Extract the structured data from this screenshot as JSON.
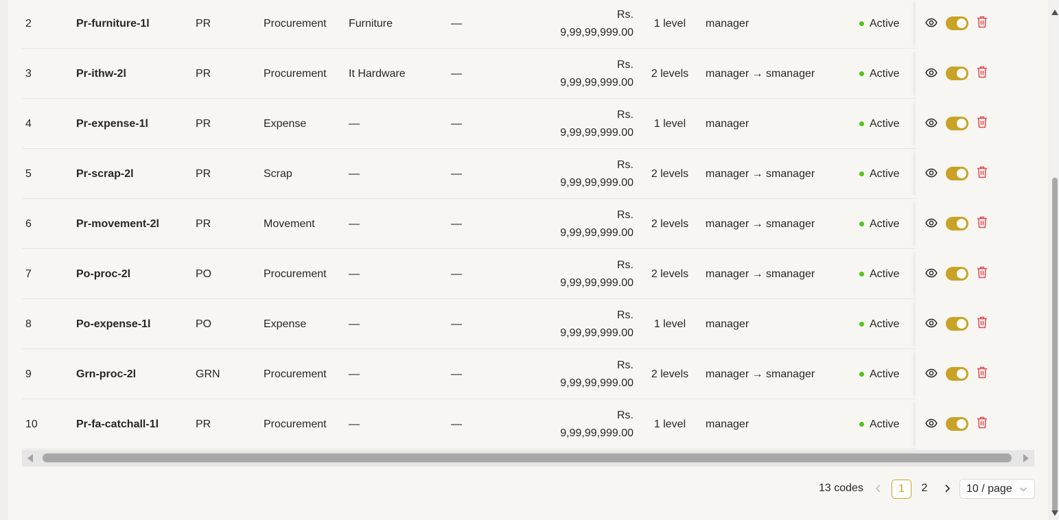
{
  "rows": [
    {
      "no": "2",
      "code": "Pr-furniture-1l",
      "type": "PR",
      "category": "Procurement",
      "subcategory": "Furniture",
      "dept": "—",
      "currency": "Rs.",
      "amount": "9,99,99,999.00",
      "levels": "1 level",
      "chain": "manager",
      "status": "Active"
    },
    {
      "no": "3",
      "code": "Pr-ithw-2l",
      "type": "PR",
      "category": "Procurement",
      "subcategory": "It Hardware",
      "dept": "—",
      "currency": "Rs.",
      "amount": "9,99,99,999.00",
      "levels": "2 levels",
      "chain": "manager → smanager",
      "status": "Active"
    },
    {
      "no": "4",
      "code": "Pr-expense-1l",
      "type": "PR",
      "category": "Expense",
      "subcategory": "—",
      "dept": "—",
      "currency": "Rs.",
      "amount": "9,99,99,999.00",
      "levels": "1 level",
      "chain": "manager",
      "status": "Active"
    },
    {
      "no": "5",
      "code": "Pr-scrap-2l",
      "type": "PR",
      "category": "Scrap",
      "subcategory": "—",
      "dept": "—",
      "currency": "Rs.",
      "amount": "9,99,99,999.00",
      "levels": "2 levels",
      "chain": "manager → smanager",
      "status": "Active"
    },
    {
      "no": "6",
      "code": "Pr-movement-2l",
      "type": "PR",
      "category": "Movement",
      "subcategory": "—",
      "dept": "—",
      "currency": "Rs.",
      "amount": "9,99,99,999.00",
      "levels": "2 levels",
      "chain": "manager → smanager",
      "status": "Active"
    },
    {
      "no": "7",
      "code": "Po-proc-2l",
      "type": "PO",
      "category": "Procurement",
      "subcategory": "—",
      "dept": "—",
      "currency": "Rs.",
      "amount": "9,99,99,999.00",
      "levels": "2 levels",
      "chain": "manager → smanager",
      "status": "Active"
    },
    {
      "no": "8",
      "code": "Po-expense-1l",
      "type": "PO",
      "category": "Expense",
      "subcategory": "—",
      "dept": "—",
      "currency": "Rs.",
      "amount": "9,99,99,999.00",
      "levels": "1 level",
      "chain": "manager",
      "status": "Active"
    },
    {
      "no": "9",
      "code": "Grn-proc-2l",
      "type": "GRN",
      "category": "Procurement",
      "subcategory": "—",
      "dept": "—",
      "currency": "Rs.",
      "amount": "9,99,99,999.00",
      "levels": "2 levels",
      "chain": "manager → smanager",
      "status": "Active"
    },
    {
      "no": "10",
      "code": "Pr-fa-catchall-1l",
      "type": "PR",
      "category": "Procurement",
      "subcategory": "—",
      "dept": "—",
      "currency": "Rs.",
      "amount": "9,99,99,999.00",
      "levels": "1 level",
      "chain": "manager",
      "status": "Active"
    }
  ],
  "actions": {
    "view_icon": "eye-icon",
    "toggle_on": true,
    "delete_icon": "trash-icon"
  },
  "pagination": {
    "total": "13 codes",
    "pages": [
      "1",
      "2"
    ],
    "current": "1",
    "page_size": "10 / page"
  },
  "colors": {
    "accent": "#c9a227",
    "status_active": "#52c41a",
    "delete": "#e5484d"
  }
}
